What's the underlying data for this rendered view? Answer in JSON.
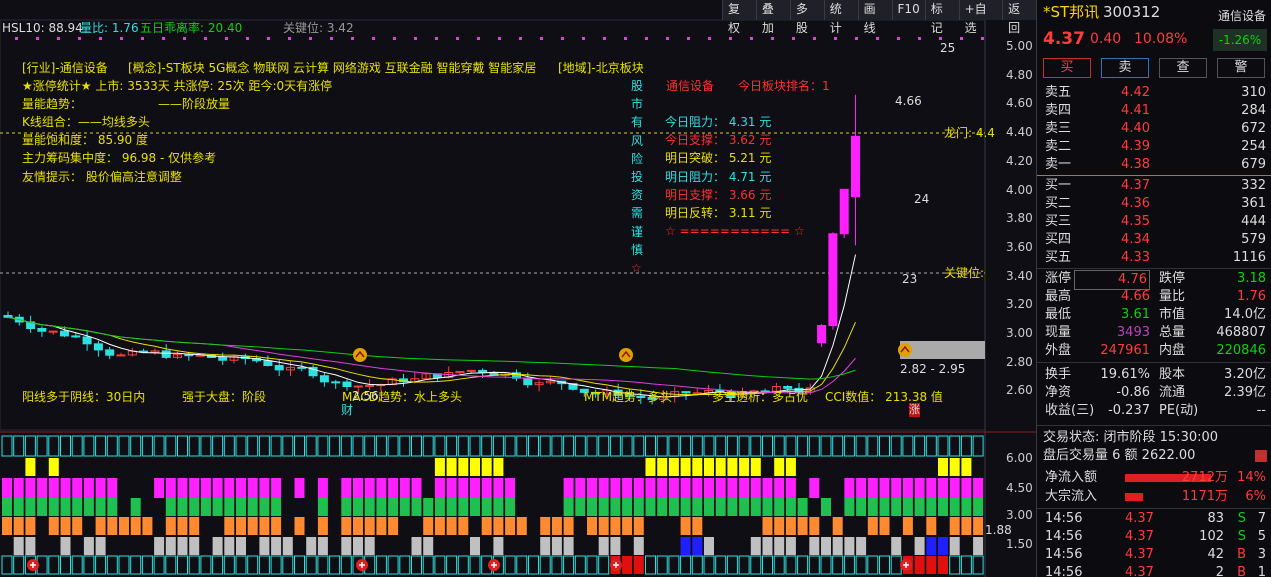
{
  "topbar": [
    "复权",
    "叠加",
    "多股",
    "统计",
    "画线",
    "F10",
    "标记",
    "+自选",
    "返回"
  ],
  "header": {
    "hsl": "HSL10: 88.94",
    "liangbi": "量比: 1.76",
    "wuri": "五日乖离率: 20.40",
    "guanjian": "关键位: 3.42"
  },
  "info": {
    "hangye": "[行业]-通信设备",
    "gainian": "[概念]-ST板块 5G概念 物联网 云计算 网络游戏 互联金融 智能穿戴 智能家居",
    "diyu": "[地域]-北京板块",
    "line1": "★涨停统计★  上市: 3533天  共涨停: 25次  距今:0天有涨停",
    "line2": "量能趋势：",
    "line2b": "——阶段放量",
    "line3": "K线组合：——均线多头",
    "line4": "量能饱和度： 85.90 度",
    "line5": "主力筹码集中度： 96.98 - 仅供参考",
    "line6": "友情提示： 股价偏高注意调整"
  },
  "risk": [
    "股",
    "市",
    "有",
    "风",
    "险",
    "投",
    "资",
    "需",
    "谨",
    "慎",
    "☆"
  ],
  "levels": {
    "title": "通信设备",
    "rank": "今日板块排名：1",
    "items": [
      "今日阻力： 4.31 元",
      "今日支撑： 3.62 元",
      "明日突破： 5.21 元",
      "明日阻力： 4.71 元",
      "明日支撑： 3.66 元",
      "明日反转： 3.11 元"
    ],
    "stars": "☆ =========== ☆"
  },
  "bottom": {
    "yang": "阳线多于阴线：30日内",
    "qiang": "强于大盘：阶段",
    "macd": "MACD趋势：水上多头",
    "mtm": "MTM趋势：多头",
    "duokong": "多空透析：多占优",
    "cci": "CCI数值： 213.38 值"
  },
  "annot": {
    "hi": "4.66",
    "lo": "2.56",
    "n25": "25",
    "n24": "24",
    "n23": "23",
    "longmen": "龙门: 4.4",
    "guanjian": "关键位:",
    "range": "2.82 - 2.95",
    "cai": "财",
    "zhang": "涨",
    "v188": "1.88"
  },
  "yaxis": [
    "5.00",
    "4.80",
    "4.60",
    "4.40",
    "4.20",
    "4.00",
    "3.80",
    "3.60",
    "3.40",
    "3.20",
    "3.00",
    "2.80",
    "2.60"
  ],
  "yaxis2": [
    "6.00",
    "4.50",
    "3.00",
    "1.50"
  ],
  "stock": {
    "name": "*ST邦讯",
    "code": "300312",
    "sector": "通信设备",
    "price": "4.37",
    "chg": "0.40",
    "pct": "10.08%",
    "sectorpct": "-1.26%"
  },
  "buttons": [
    "买",
    "卖",
    "查",
    "警"
  ],
  "asks": [
    [
      "卖五",
      "4.42",
      "310"
    ],
    [
      "卖四",
      "4.41",
      "284"
    ],
    [
      "卖三",
      "4.40",
      "672"
    ],
    [
      "卖二",
      "4.39",
      "254"
    ],
    [
      "卖一",
      "4.38",
      "679"
    ]
  ],
  "bids": [
    [
      "买一",
      "4.37",
      "332"
    ],
    [
      "买二",
      "4.36",
      "361"
    ],
    [
      "买三",
      "4.35",
      "444"
    ],
    [
      "买四",
      "4.34",
      "579"
    ],
    [
      "买五",
      "4.33",
      "1116"
    ]
  ],
  "stats": [
    [
      "涨停",
      "4.76",
      "跌停",
      "3.18"
    ],
    [
      "最高",
      "4.66",
      "量比",
      "1.76"
    ],
    [
      "最低",
      "3.61",
      "市值",
      "14.0亿"
    ],
    [
      "现量",
      "3493",
      "总量",
      "468807"
    ],
    [
      "外盘",
      "247961",
      "内盘",
      "220846"
    ]
  ],
  "stats2": [
    [
      "换手",
      "19.61%",
      "股本",
      "3.20亿"
    ],
    [
      "净资",
      "-0.86",
      "流通",
      "2.39亿"
    ],
    [
      "收益(三)",
      "-0.237",
      "PE(动)",
      "--"
    ]
  ],
  "status": {
    "line1": "交易状态: 闭市阶段 15:30:00",
    "line2": "盘后交易量 6 额 2622.00"
  },
  "flow": [
    [
      "净流入额",
      "2712万",
      "14%"
    ],
    [
      "大宗流入",
      "1171万",
      "6%"
    ]
  ],
  "ticks": [
    [
      "14:56",
      "4.37",
      "83",
      "S",
      "7"
    ],
    [
      "14:56",
      "4.37",
      "102",
      "S",
      "5"
    ],
    [
      "14:56",
      "4.37",
      "42",
      "B",
      "3"
    ],
    [
      "14:56",
      "4.37",
      "2",
      "B",
      "1"
    ]
  ],
  "colors": {
    "up": "#ff3c3c",
    "down": "#2ee0e0",
    "ma5": "#ffffff",
    "ma10": "#e8e000",
    "ma20": "#e040e0",
    "ma60": "#10d010"
  }
}
